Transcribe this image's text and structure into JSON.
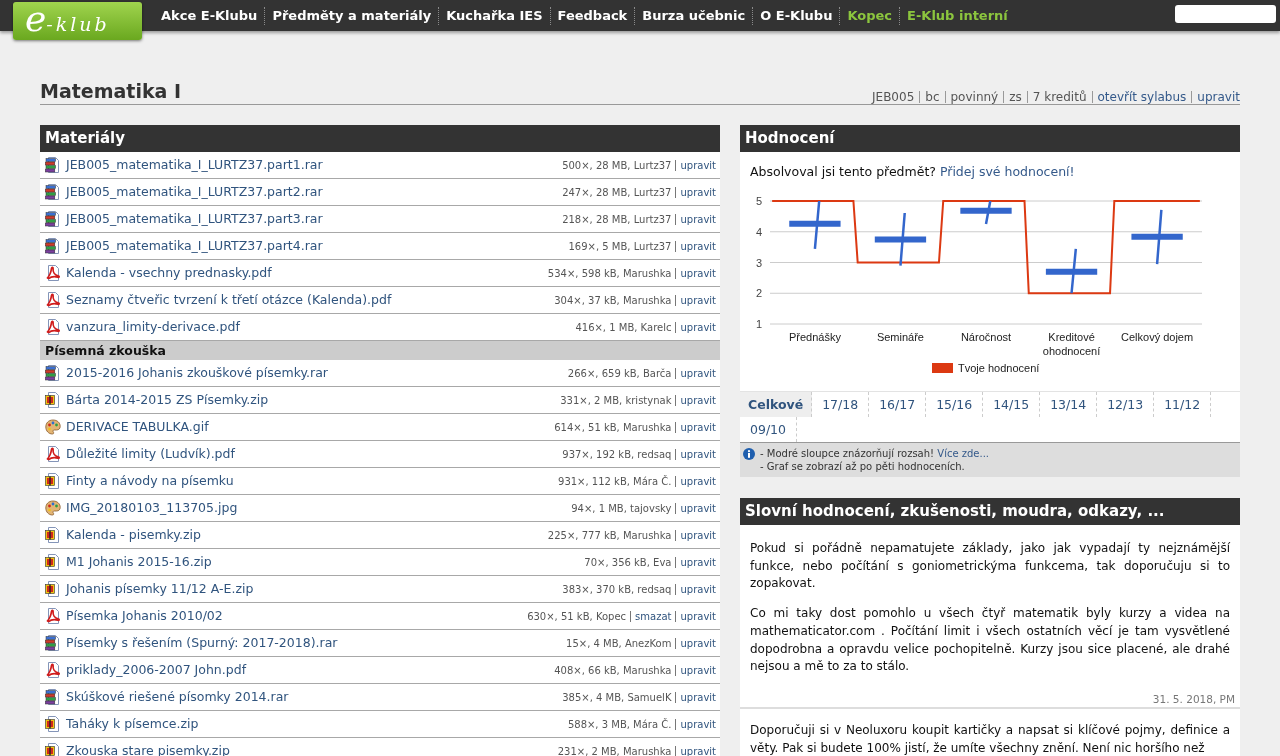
{
  "nav": {
    "logo": "e-klub",
    "items": [
      {
        "label": "Akce E-Klubu",
        "color": "#ffffff"
      },
      {
        "label": "Předměty a materiály",
        "color": "#ffffff"
      },
      {
        "label": "Kuchařka IES",
        "color": "#ffffff"
      },
      {
        "label": "Feedback",
        "color": "#ffffff"
      },
      {
        "label": "Burza učebnic",
        "color": "#ffffff"
      },
      {
        "label": "O E-Klubu",
        "color": "#ffffff"
      },
      {
        "label": "Kopec",
        "color": "#8cc63e"
      },
      {
        "label": "E-Klub interní",
        "color": "#8cc63e"
      }
    ]
  },
  "course": {
    "title": "Matematika I",
    "meta": [
      {
        "label": "JEB005",
        "kind": "text"
      },
      {
        "label": "bc",
        "kind": "text"
      },
      {
        "label": "povinný",
        "kind": "text"
      },
      {
        "label": "zs",
        "kind": "text"
      },
      {
        "label": "7 kreditů",
        "kind": "text"
      },
      {
        "label": "otevřít sylabus",
        "kind": "link"
      },
      {
        "label": "upravit",
        "kind": "link"
      }
    ]
  },
  "materials": {
    "title": "Materiály",
    "groups": [
      {
        "files": [
          {
            "name": "JEB005_matematika_I_LURTZ37.part1.rar",
            "kind": "rar",
            "info": "500×, 28 MB, Lurtz37",
            "actions": [
              "upravit"
            ]
          },
          {
            "name": "JEB005_matematika_I_LURTZ37.part2.rar",
            "kind": "rar",
            "info": "247×, 28 MB, Lurtz37",
            "actions": [
              "upravit"
            ]
          },
          {
            "name": "JEB005_matematika_I_LURTZ37.part3.rar",
            "kind": "rar",
            "info": "218×, 28 MB, Lurtz37",
            "actions": [
              "upravit"
            ]
          },
          {
            "name": "JEB005_matematika_I_LURTZ37.part4.rar",
            "kind": "rar",
            "info": "169×, 5 MB, Lurtz37",
            "actions": [
              "upravit"
            ]
          },
          {
            "name": "Kalenda - vsechny prednasky.pdf",
            "kind": "pdf",
            "info": "534×, 598 kB, Marushka",
            "actions": [
              "upravit"
            ]
          },
          {
            "name": "Seznamy čtveřic tvrzení k třetí otázce (Kalenda).pdf",
            "kind": "pdf",
            "info": "304×, 37 kB, Marushka",
            "actions": [
              "upravit"
            ]
          },
          {
            "name": "vanzura_limity-derivace.pdf",
            "kind": "pdf",
            "info": "416×, 1 MB, Karelc",
            "actions": [
              "upravit"
            ]
          }
        ]
      },
      {
        "heading": "Písemná zkouška",
        "files": [
          {
            "name": "2015-2016 Johanis zkouškové písemky.rar",
            "kind": "rar",
            "info": "266×, 659 kB, Barča",
            "actions": [
              "upravit"
            ]
          },
          {
            "name": "Bárta 2014-2015 ZS Písemky.zip",
            "kind": "zip",
            "info": "331×, 2 MB, kristynak",
            "actions": [
              "upravit"
            ]
          },
          {
            "name": "DERIVACE TABULKA.gif",
            "kind": "image",
            "info": "614×, 51 kB, Marushka",
            "actions": [
              "upravit"
            ]
          },
          {
            "name": "Důležité limity (Ludvík).pdf",
            "kind": "pdf",
            "info": "937×, 192 kB, redsaq",
            "actions": [
              "upravit"
            ]
          },
          {
            "name": "Finty a návody na písemku",
            "kind": "zip",
            "info": "931×, 112 kB, Mára Č.",
            "actions": [
              "upravit"
            ]
          },
          {
            "name": "IMG_20180103_113705.jpg",
            "kind": "image",
            "info": "94×, 1 MB, tajovsky",
            "actions": [
              "upravit"
            ]
          },
          {
            "name": "Kalenda - pisemky.zip",
            "kind": "zip",
            "info": "225×, 777 kB, Marushka",
            "actions": [
              "upravit"
            ]
          },
          {
            "name": "M1 Johanis 2015-16.zip",
            "kind": "zip",
            "info": "70×, 356 kB, Eva",
            "actions": [
              "upravit"
            ]
          },
          {
            "name": "Johanis písemky 11/12 A-E.zip",
            "kind": "zip",
            "info": "383×, 370 kB, redsaq",
            "actions": [
              "upravit"
            ]
          },
          {
            "name": "Písemka Johanis 2010/02",
            "kind": "pdf",
            "info": "630×, 51 kB, Kopec",
            "actions": [
              "smazat",
              "upravit"
            ]
          },
          {
            "name": "Písemky s řešením (Spurný: 2017-2018).rar",
            "kind": "rar",
            "info": "15×, 4 MB, AnezKom",
            "actions": [
              "upravit"
            ]
          },
          {
            "name": "priklady_2006-2007 John.pdf",
            "kind": "pdf",
            "info": "408×, 66 kB, Marushka",
            "actions": [
              "upravit"
            ]
          },
          {
            "name": "Skúškové riešené písomky 2014.rar",
            "kind": "rar",
            "info": "385×, 4 MB, SamuelK",
            "actions": [
              "upravit"
            ]
          },
          {
            "name": "Taháky k písemce.zip",
            "kind": "zip",
            "info": "588×, 3 MB, Mára Č.",
            "actions": [
              "upravit"
            ]
          },
          {
            "name": "Zkouska stare pisemky.zip",
            "kind": "zip",
            "info": "231×, 2 MB, Marushka",
            "actions": [
              "upravit"
            ]
          }
        ]
      }
    ]
  },
  "rating": {
    "title": "Hodnocení",
    "prompt": "Absolvoval jsi tento předmět?",
    "prompt_link": "Přidej své hodnocení!",
    "chart_data": {
      "type": "line",
      "categories": [
        null,
        null,
        null,
        null,
        null,
        null,
        null,
        null,
        null,
        null,
        "Přednášky",
        null,
        null,
        null,
        null,
        null,
        null,
        null,
        null,
        null,
        null,
        null,
        null,
        null,
        null,
        null,
        null,
        null,
        null,
        null,
        "Semináře",
        null,
        null,
        null,
        null,
        null,
        null,
        null,
        null,
        null,
        null,
        null,
        null,
        null,
        null,
        null,
        null,
        null,
        null,
        null,
        "Náročnost",
        null,
        null,
        null,
        null,
        null,
        null,
        null,
        null,
        null,
        null,
        null,
        null,
        null,
        null,
        null,
        null,
        null,
        null,
        null,
        "Kreditové ohodnocení",
        null,
        null,
        null,
        null,
        null,
        null,
        null,
        null,
        null,
        null,
        null,
        null,
        null,
        null,
        null,
        null,
        null,
        null,
        null,
        "Celkový dojem",
        null,
        null,
        null,
        null,
        null,
        null,
        null,
        null,
        null,
        null
      ],
      "ylim": [
        1,
        5
      ],
      "yticks": [
        1,
        2,
        3,
        4,
        5
      ],
      "grid": true,
      "series": [
        {
          "name": "Tvoje hodnocení",
          "color": "#dc3912",
          "values": [
            5,
            5,
            5,
            5,
            5,
            5,
            5,
            5,
            5,
            5,
            5,
            5,
            5,
            5,
            5,
            5,
            5,
            5,
            5,
            5,
            3,
            3,
            3,
            3,
            3,
            3,
            3,
            3,
            3,
            3,
            3,
            3,
            3,
            3,
            3,
            3,
            3,
            3,
            3,
            3,
            5,
            5,
            5,
            5,
            5,
            5,
            5,
            5,
            5,
            5,
            5,
            5,
            5,
            5,
            5,
            5,
            5,
            5,
            5,
            5,
            2,
            2,
            2,
            2,
            2,
            2,
            2,
            2,
            2,
            2,
            2,
            2,
            2,
            2,
            2,
            2,
            2,
            2,
            2,
            2,
            5,
            5,
            5,
            5,
            5,
            5,
            5,
            5,
            5,
            5,
            5,
            5,
            5,
            5,
            5,
            5,
            5,
            5,
            5,
            5,
            5
          ]
        },
        {
          "color": "#3366cc",
          "values": [
            null,
            null,
            null,
            null,
            4.26,
            4.26,
            4.26,
            4.26,
            4.26,
            4.26,
            4.26,
            4.26,
            4.26,
            4.26,
            4.26,
            4.26,
            4.26,
            null,
            null,
            null,
            null,
            null,
            null,
            null,
            3.75,
            3.75,
            3.75,
            3.75,
            3.75,
            3.75,
            3.75,
            3.75,
            3.75,
            3.75,
            3.75,
            3.75,
            3.75,
            null,
            null,
            null,
            null,
            null,
            null,
            null,
            4.68,
            4.68,
            4.68,
            4.68,
            4.68,
            4.68,
            4.68,
            4.68,
            4.68,
            4.68,
            4.68,
            4.68,
            4.68,
            null,
            null,
            null,
            null,
            null,
            null,
            null,
            2.7,
            2.7,
            2.7,
            2.7,
            2.7,
            2.7,
            2.7,
            2.7,
            2.7,
            2.7,
            2.7,
            2.7,
            2.7,
            null,
            null,
            null,
            null,
            null,
            null,
            null,
            3.84,
            3.84,
            3.84,
            3.84,
            3.84,
            3.84,
            3.84,
            3.84,
            3.84,
            3.84,
            3.84,
            3.84,
            3.84,
            null,
            null,
            null,
            null
          ]
        },
        {
          "color": "#3366cc",
          "values": [
            null,
            null,
            null,
            null,
            null,
            null,
            null,
            null,
            null,
            null,
            3.44,
            5,
            null,
            null,
            null,
            null,
            null,
            null,
            null,
            null,
            null,
            null,
            null,
            null,
            null,
            null,
            null,
            null,
            null,
            null,
            2.9,
            4.61,
            null,
            null,
            null,
            null,
            null,
            null,
            null,
            null,
            null,
            null,
            null,
            null,
            null,
            null,
            null,
            null,
            null,
            null,
            4.25,
            5,
            null,
            null,
            null,
            null,
            null,
            null,
            null,
            null,
            null,
            null,
            null,
            null,
            null,
            null,
            null,
            null,
            null,
            null,
            2,
            3.44,
            null,
            null,
            null,
            null,
            null,
            null,
            null,
            null,
            null,
            null,
            null,
            null,
            null,
            null,
            null,
            null,
            null,
            null,
            2.95,
            4.71,
            null,
            null,
            null,
            null,
            null,
            null,
            null,
            null,
            null
          ]
        }
      ]
    },
    "tabs": [
      {
        "label": "Celkové",
        "selected": true
      },
      {
        "label": "17/18",
        "selected": false
      },
      {
        "label": "16/17",
        "selected": false
      },
      {
        "label": "15/16",
        "selected": false
      },
      {
        "label": "14/15",
        "selected": false
      },
      {
        "label": "13/14",
        "selected": false
      },
      {
        "label": "12/13",
        "selected": false
      },
      {
        "label": "11/12",
        "selected": false
      },
      {
        "label": "09/10",
        "selected": false
      }
    ],
    "notes": [
      {
        "text": "- Modré sloupce znázorňují rozsah!",
        "link": "Více zde..."
      },
      {
        "text": "- Graf se zobrazí až po pěti hodnoceních."
      }
    ]
  },
  "comments": {
    "title": "Slovní hodnocení, zkušenosti, moudra, odkazy, ...",
    "items": [
      {
        "paragraphs": [
          "Pokud si pořádně nepamatujete základy, jako jak vypadají ty nejznámější funkce, nebo počítání s goniometrickýma funkcema, tak doporučuju si to zopakovat.",
          "Co mi taky dost pomohlo u všech čtyř matematik byly kurzy a videa na mathematicator.com . Počítání limit i všech ostatních věcí je tam vysvětlené dopodrobna a opravdu velice pochopitelně. Kurzy jsou sice placené, ale drahé nejsou a mě to za to stálo."
        ],
        "date": "31. 5. 2018, PM"
      },
      {
        "paragraphs": [
          "Doporučuji si v Neoluxoru koupit kartičky a napsat si klíčové pojmy, definice a věty. Pak si budete 100% jistí, že umíte všechny znění. Není nic horšího než"
        ]
      }
    ]
  }
}
